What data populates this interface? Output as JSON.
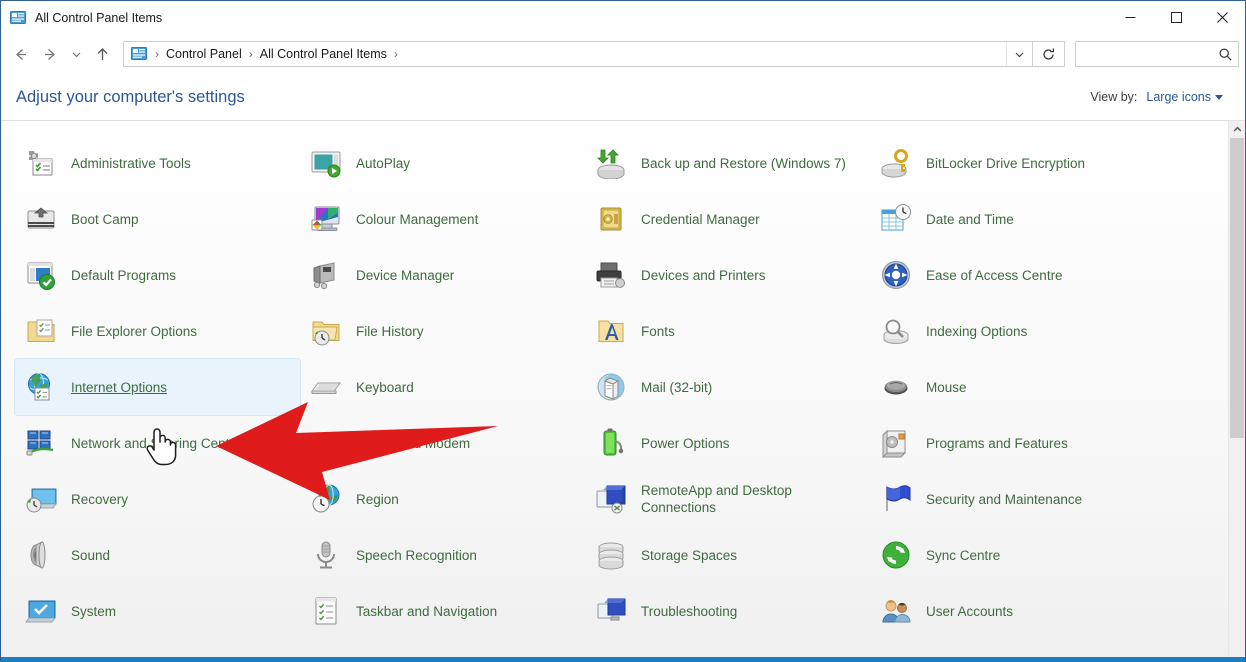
{
  "window": {
    "title": "All Control Panel Items",
    "title_icon": "control-panel-icon",
    "controls": {
      "minimize": "minimize-icon",
      "maximize": "maximize-icon",
      "close": "close-icon"
    }
  },
  "nav": {
    "back": "back-arrow-icon",
    "forward": "forward-arrow-icon",
    "recent": "recent-locations-icon",
    "up": "up-arrow-icon",
    "breadcrumb_icon": "control-panel-icon",
    "breadcrumbs": [
      "Control Panel",
      "All Control Panel Items"
    ],
    "separator": "›",
    "dropdown": "chevron-down-icon",
    "refresh": "refresh-icon"
  },
  "search": {
    "value": "",
    "placeholder": "",
    "icon": "search-icon"
  },
  "header": {
    "page_title": "Adjust your computer's settings",
    "view_by_label": "View by:",
    "view_by_value": "Large icons",
    "view_by_caret": "caret-down-icon"
  },
  "colors": {
    "accent_blue": "#2b5797",
    "label_green": "#3f6b3f",
    "hover_highlight": "#e8f3fb",
    "annotation_red": "#e01b1b",
    "bottom_strip": "#1b7fc4"
  },
  "items": [
    {
      "label": "Administrative Tools",
      "icon": "administrative-tools-icon"
    },
    {
      "label": "AutoPlay",
      "icon": "autoplay-icon"
    },
    {
      "label": "Back up and Restore (Windows 7)",
      "icon": "backup-restore-icon"
    },
    {
      "label": "BitLocker Drive Encryption",
      "icon": "bitlocker-icon"
    },
    {
      "label": "Boot Camp",
      "icon": "boot-camp-icon"
    },
    {
      "label": "Colour Management",
      "icon": "colour-management-icon"
    },
    {
      "label": "Credential Manager",
      "icon": "credential-manager-icon"
    },
    {
      "label": "Date and Time",
      "icon": "date-and-time-icon"
    },
    {
      "label": "Default Programs",
      "icon": "default-programs-icon"
    },
    {
      "label": "Device Manager",
      "icon": "device-manager-icon"
    },
    {
      "label": "Devices and Printers",
      "icon": "devices-and-printers-icon"
    },
    {
      "label": "Ease of Access Centre",
      "icon": "ease-of-access-icon"
    },
    {
      "label": "File Explorer Options",
      "icon": "file-explorer-options-icon"
    },
    {
      "label": "File History",
      "icon": "file-history-icon"
    },
    {
      "label": "Fonts",
      "icon": "fonts-icon"
    },
    {
      "label": "Indexing Options",
      "icon": "indexing-options-icon"
    },
    {
      "label": "Internet Options",
      "icon": "internet-options-icon",
      "hovered": true
    },
    {
      "label": "Keyboard",
      "icon": "keyboard-icon"
    },
    {
      "label": "Mail (32-bit)",
      "icon": "mail-icon"
    },
    {
      "label": "Mouse",
      "icon": "mouse-icon"
    },
    {
      "label": "Network and Sharing Centre",
      "icon": "network-sharing-icon"
    },
    {
      "label": "Phone and Modem",
      "icon": "phone-and-modem-icon"
    },
    {
      "label": "Power Options",
      "icon": "power-options-icon"
    },
    {
      "label": "Programs and Features",
      "icon": "programs-and-features-icon"
    },
    {
      "label": "Recovery",
      "icon": "recovery-icon"
    },
    {
      "label": "Region",
      "icon": "region-icon"
    },
    {
      "label": "RemoteApp and Desktop Connections",
      "icon": "remoteapp-icon"
    },
    {
      "label": "Security and Maintenance",
      "icon": "security-maintenance-icon"
    },
    {
      "label": "Sound",
      "icon": "sound-icon"
    },
    {
      "label": "Speech Recognition",
      "icon": "speech-recognition-icon"
    },
    {
      "label": "Storage Spaces",
      "icon": "storage-spaces-icon"
    },
    {
      "label": "Sync Centre",
      "icon": "sync-centre-icon"
    },
    {
      "label": "System",
      "icon": "system-icon"
    },
    {
      "label": "Taskbar and Navigation",
      "icon": "taskbar-navigation-icon"
    },
    {
      "label": "Troubleshooting",
      "icon": "troubleshooting-icon"
    },
    {
      "label": "User Accounts",
      "icon": "user-accounts-icon"
    }
  ],
  "annotation": {
    "arrow": "red-arrow-pointing-left",
    "target": "Internet Options"
  },
  "cursor": {
    "type": "hand-pointer-cursor"
  },
  "scrollbar": {
    "up_button": "scroll-up-icon",
    "thumb": "scrollbar-thumb"
  }
}
